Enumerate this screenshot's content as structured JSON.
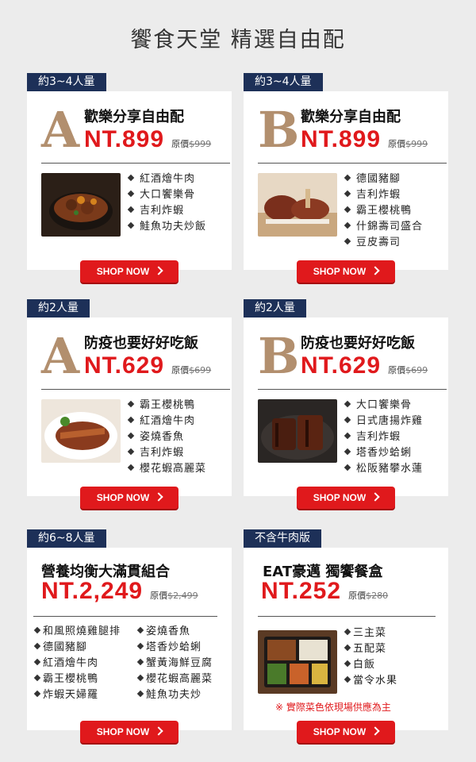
{
  "page_title": "饗食天堂  精選自由配",
  "shop_label": "SHOP NOW",
  "cards": [
    {
      "tag": "約3~4人量",
      "letter": "A",
      "title": "歡樂分享自由配",
      "price": "NT.899",
      "orig_label": "原價",
      "orig_price": "$999",
      "items": [
        "紅酒燴牛肉",
        "大口饗樂骨",
        "吉利炸蝦",
        "鮭魚功夫炒飯"
      ]
    },
    {
      "tag": "約3~4人量",
      "letter": "B",
      "title": "歡樂分享自由配",
      "price": "NT.899",
      "orig_label": "原價",
      "orig_price": "$999",
      "items": [
        "德國豬腳",
        "吉利炸蝦",
        "霸王櫻桃鴨",
        "什錦壽司盛合",
        "豆皮壽司"
      ]
    },
    {
      "tag": "約2人量",
      "letter": "A",
      "title": "防疫也要好好吃飯",
      "price": "NT.629",
      "orig_label": "原價",
      "orig_price": "$699",
      "items": [
        "霸王櫻桃鴨",
        "紅酒燴牛肉",
        "姿燒香魚",
        "吉利炸蝦",
        "櫻花蝦高麗菜"
      ]
    },
    {
      "tag": "約2人量",
      "letter": "B",
      "title": "防疫也要好好吃飯",
      "price": "NT.629",
      "orig_label": "原價",
      "orig_price": "$699",
      "items": [
        "大口饗樂骨",
        "日式唐揚炸雞",
        "吉利炸蝦",
        "塔香炒蛤蜊",
        "松阪豬攀水蓮"
      ]
    },
    {
      "tag": "約6~8人量",
      "title": "營養均衡大滿貫組合",
      "price": "NT.2,249",
      "orig_label": "原價",
      "orig_price": "$2,499",
      "items_left": [
        "和風照燒雞腿排",
        "德國豬腳",
        "紅酒燴牛肉",
        "霸王櫻桃鴨",
        "炸蝦天婦羅"
      ],
      "items_right": [
        "姿燒香魚",
        "塔香炒蛤蜊",
        "蟹黃海鮮豆腐",
        "櫻花蝦高麗菜",
        "鮭魚功夫炒"
      ]
    },
    {
      "tag": "不含牛肉版",
      "title": "EAT豪邁 獨饗餐盒",
      "price": "NT.252",
      "orig_label": "原價",
      "orig_price": "$280",
      "items": [
        "三主菜",
        "五配菜",
        "白飯",
        "當令水果"
      ],
      "note": "※ 實際菜色依現場供應為主"
    }
  ]
}
